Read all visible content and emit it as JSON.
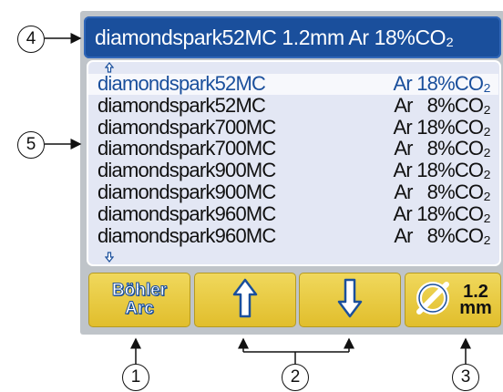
{
  "title_bar": {
    "text": "diamondspark52MC 1.2mm Ar 18%CO₂"
  },
  "scroll": {
    "up_icon": "arrow-up-small-icon",
    "down_icon": "arrow-down-small-icon"
  },
  "list": {
    "selected_index": 0,
    "rows": [
      {
        "material": "diamondspark52MC",
        "gas": "Ar 18%CO₂"
      },
      {
        "material": "diamondspark52MC",
        "gas": "Ar   8%CO₂"
      },
      {
        "material": "diamondspark700MC",
        "gas": "Ar 18%CO₂"
      },
      {
        "material": "diamondspark700MC",
        "gas": "Ar   8%CO₂"
      },
      {
        "material": "diamondspark900MC",
        "gas": "Ar 18%CO₂"
      },
      {
        "material": "diamondspark900MC",
        "gas": "Ar   8%CO₂"
      },
      {
        "material": "diamondspark960MC",
        "gas": "Ar 18%CO₂"
      },
      {
        "material": "diamondspark960MC",
        "gas": "Ar   8%CO₂"
      }
    ]
  },
  "softkeys": {
    "brand_line1": "Böhler",
    "brand_line2": "Arc",
    "up_icon": "arrow-up-icon",
    "down_icon": "arrow-down-icon",
    "diameter_icon": "diameter-icon",
    "diameter_value": "1.2",
    "diameter_unit": "mm"
  },
  "callouts": {
    "c1": "1",
    "c2": "2",
    "c3": "3",
    "c4": "4",
    "c5": "5"
  },
  "colors": {
    "title_bg": "#1a4f9c",
    "list_bg": "#e3e7f4",
    "softkey_yellow": "#e8c840",
    "screen_gray": "#bfc4c9"
  }
}
